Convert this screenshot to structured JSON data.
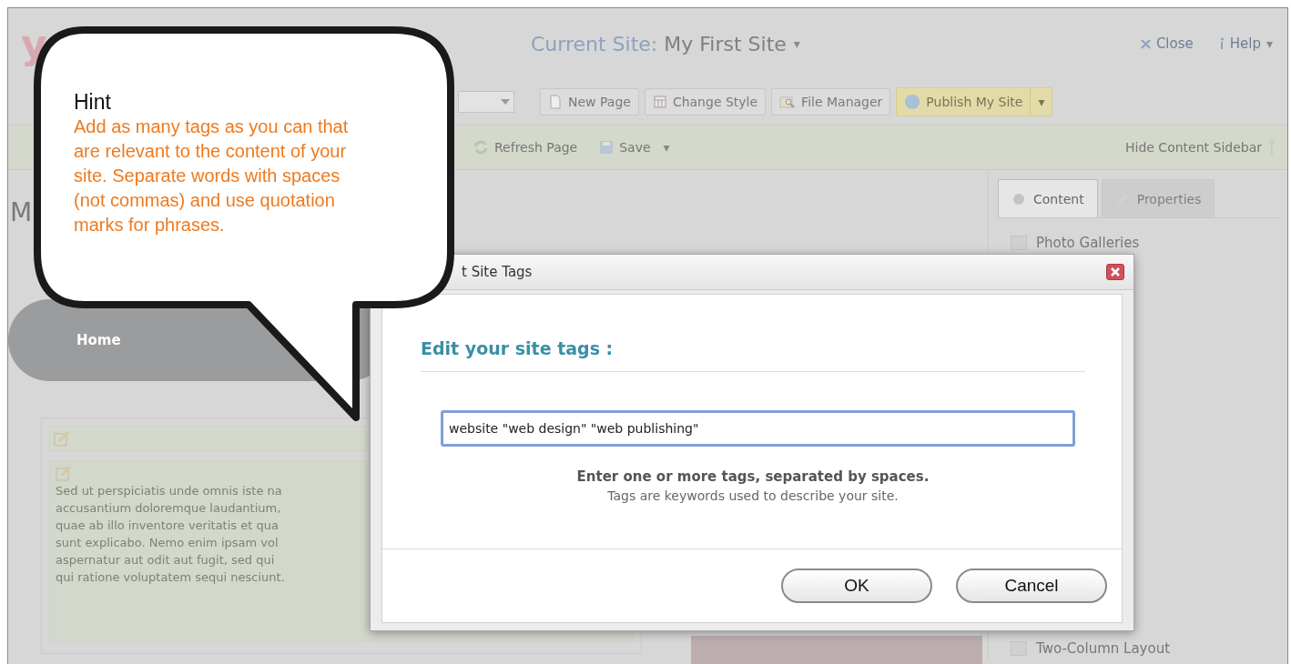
{
  "app": {
    "logo": "y",
    "current_site_label": "Current Site:",
    "current_site": "My First Site",
    "current_site_caret": "▾",
    "close": "Close",
    "help": "Help",
    "help_caret": "▾",
    "toolbar": [
      "New Page",
      "Change Style",
      "File Manager"
    ],
    "publish": "Publish My Site",
    "publish_caret": "▾",
    "refresh": "Refresh Page",
    "save": "Save",
    "save_caret": "▾",
    "hide_sidebar": "Hide Content Sidebar",
    "page_title": "M",
    "nav": [
      "Home"
    ],
    "body_text_lines": [
      "Sed ut perspiciatis unde omnis iste na",
      "accusantium doloremque laudantium,",
      "quae ab illo inventore veritatis et qua",
      "sunt explicabo. Nemo enim ipsam vol",
      "aspernatur aut odit aut fugit, sed qui",
      "qui ratione voluptatem sequi nesciunt."
    ],
    "sidebar": {
      "tabs": [
        {
          "label": "Content",
          "selected": true
        },
        {
          "label": "Properties",
          "selected": false
        }
      ],
      "items": [
        "Photo Galleries",
        "Two-Column Layout"
      ]
    }
  },
  "dialog": {
    "title": "t Site Tags",
    "heading": "Edit your site tags :",
    "tags_value": "website \"web design\" \"web publishing\"",
    "instruction": "Enter one or more tags, separated by spaces.",
    "note": "Tags are keywords used to describe your site.",
    "buttons": [
      "OK",
      "Cancel"
    ]
  },
  "hint": {
    "title": "Hint",
    "text": "Add as many tags as you can that are relevant to the content of your site. Separate words with spaces (not commas) and use quotation marks for phrases."
  }
}
